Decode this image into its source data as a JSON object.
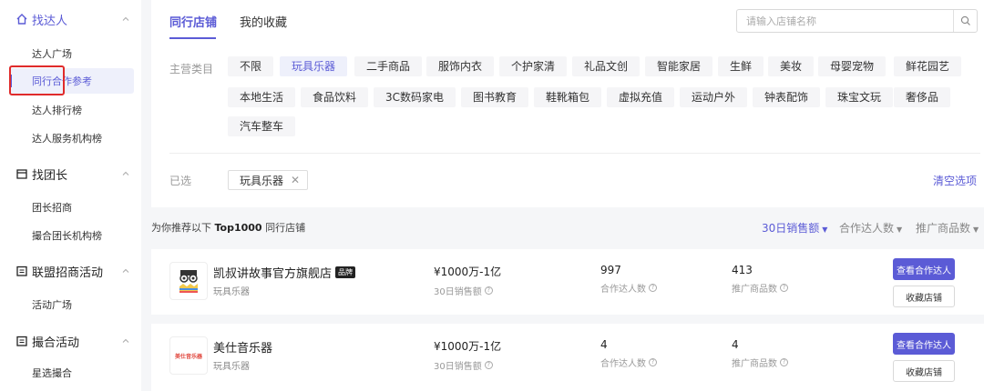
{
  "sidebar": {
    "groups": [
      {
        "label": "找达人",
        "items": [
          "达人广场",
          "同行合作参考",
          "达人排行榜",
          "达人服务机构榜"
        ]
      },
      {
        "label": "找团长",
        "items": [
          "团长招商",
          "撮合团长机构榜"
        ]
      },
      {
        "label": "联盟招商活动",
        "items": [
          "活动广场"
        ]
      },
      {
        "label": "撮合活动",
        "items": [
          "星选撮合"
        ]
      }
    ]
  },
  "tabs": [
    "同行店铺",
    "我的收藏"
  ],
  "search": {
    "placeholder": "请输入店铺名称"
  },
  "filter": {
    "label": "主营类目",
    "categories": [
      "不限",
      "玩具乐器",
      "二手商品",
      "服饰内衣",
      "个护家清",
      "礼品文创",
      "智能家居",
      "生鲜",
      "美妆",
      "母婴宠物",
      "鲜花园艺",
      "本地生活",
      "食品饮料",
      "3C数码家电",
      "图书教育",
      "鞋靴箱包",
      "虚拟充值",
      "运动户外",
      "钟表配饰",
      "珠宝文玩",
      "奢侈品",
      "汽车整车"
    ],
    "selected_label": "已选",
    "selected_chip": "玩具乐器",
    "clear_label": "清空选项"
  },
  "summary": {
    "prefix": "为你推荐以下 ",
    "bold": "Top1000",
    "suffix": " 同行店铺"
  },
  "sort": [
    "30日销售额",
    "合作达人数",
    "推广商品数"
  ],
  "stores": [
    {
      "name": "凯叔讲故事官方旗舰店",
      "badge": "品牌",
      "category": "玩具乐器",
      "sales": "¥1000万-1亿",
      "sales_label": "30日销售额",
      "creators": "997",
      "creators_label": "合作达人数",
      "products": "413",
      "products_label": "推广商品数",
      "btn_view": "查看合作达人",
      "btn_fav": "收藏店铺"
    },
    {
      "name": "美仕音乐器",
      "badge": "",
      "category": "玩具乐器",
      "logo_text": "美仕音乐器",
      "sales": "¥1000万-1亿",
      "sales_label": "30日销售额",
      "creators": "4",
      "creators_label": "合作达人数",
      "products": "4",
      "products_label": "推广商品数",
      "btn_view": "查看合作达人",
      "btn_fav": "收藏店铺"
    }
  ]
}
